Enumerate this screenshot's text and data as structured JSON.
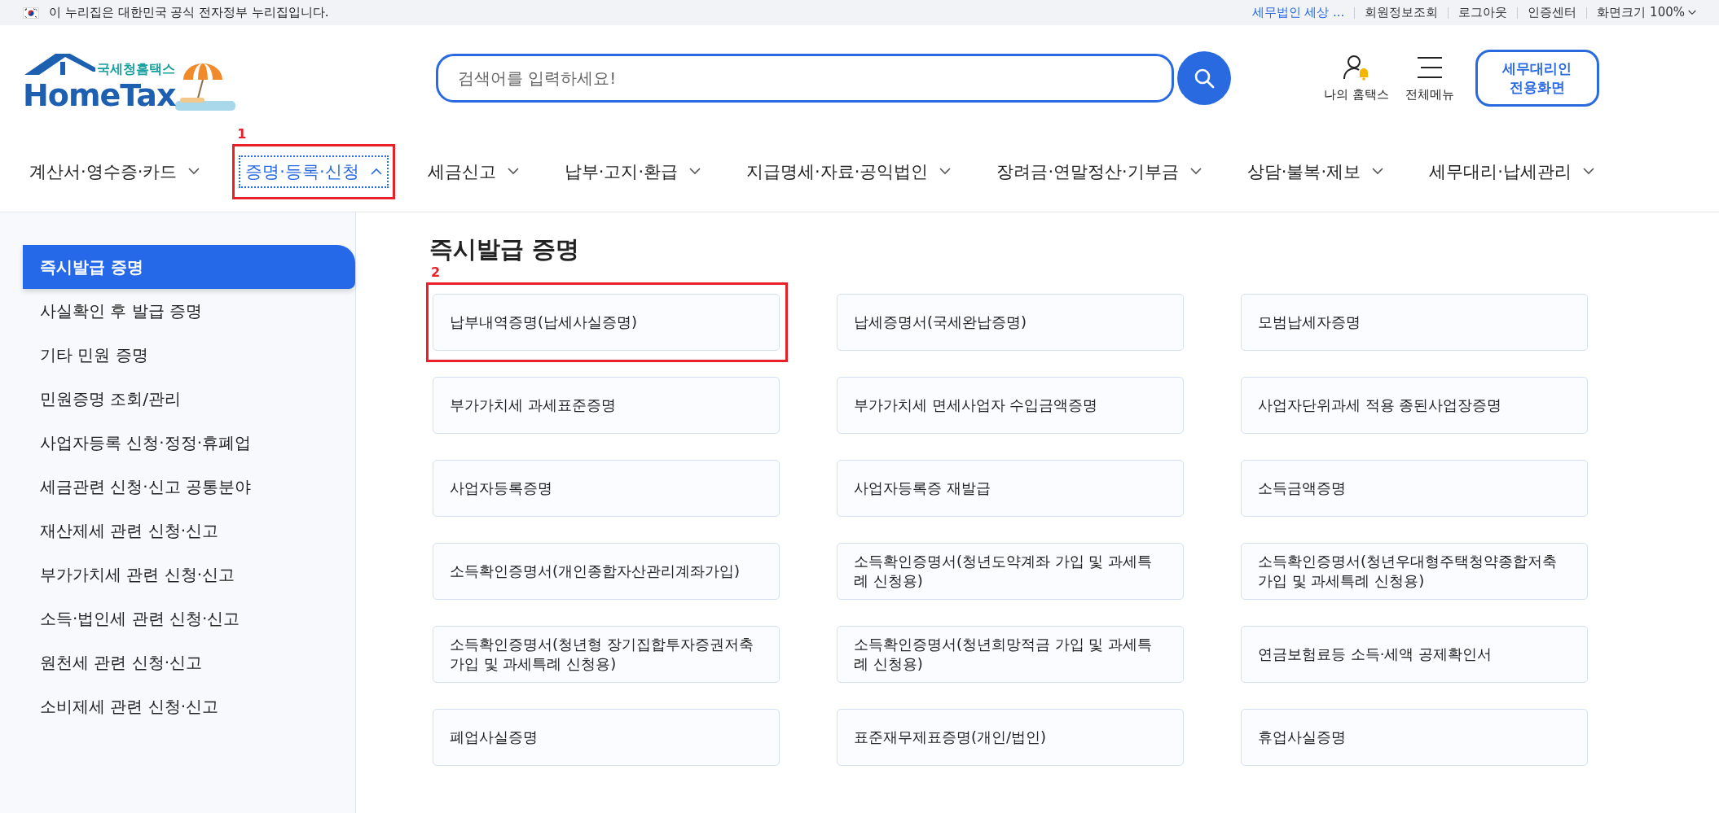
{
  "top_bar": {
    "notice": "이 누리집은 대한민국 공식 전자정부 누리집입니다.",
    "links": [
      {
        "label": "세무법인 세상 ...",
        "kind": "user"
      },
      {
        "label": "회원정보조회",
        "kind": "link"
      },
      {
        "label": "로그아웃",
        "kind": "link"
      },
      {
        "label": "인증센터",
        "kind": "link"
      },
      {
        "label": "화면크기 100%",
        "kind": "dropdown"
      }
    ]
  },
  "header": {
    "logo_sub": "국세청홈택스",
    "logo_main": "HomeTax",
    "search": {
      "placeholder": "검색어를 입력하세요!"
    },
    "my_hometax": "나의 홈택스",
    "all_menu": "전체메뉴",
    "agent_button": "세무대리인 전용화면"
  },
  "nav": [
    {
      "label": "계산서·영수증·카드",
      "selected": false
    },
    {
      "label": "증명·등록·신청",
      "selected": true,
      "annotation": "1"
    },
    {
      "label": "세금신고",
      "selected": false
    },
    {
      "label": "납부·고지·환급",
      "selected": false
    },
    {
      "label": "지급명세·자료·공익법인",
      "selected": false
    },
    {
      "label": "장려금·연말정산·기부금",
      "selected": false
    },
    {
      "label": "상담·불복·제보",
      "selected": false
    },
    {
      "label": "세무대리·납세관리",
      "selected": false
    }
  ],
  "sidebar": {
    "items": [
      {
        "label": "즉시발급 증명",
        "selected": true
      },
      {
        "label": "사실확인 후 발급 증명",
        "selected": false
      },
      {
        "label": "기타 민원 증명",
        "selected": false
      },
      {
        "label": "민원증명 조회/관리",
        "selected": false
      },
      {
        "label": "사업자등록 신청·정정·휴폐업",
        "selected": false
      },
      {
        "label": "세금관련 신청·신고 공통분야",
        "selected": false
      },
      {
        "label": "재산제세 관련 신청·신고",
        "selected": false
      },
      {
        "label": "부가가치세 관련 신청·신고",
        "selected": false
      },
      {
        "label": "소득·법인세 관련 신청·신고",
        "selected": false
      },
      {
        "label": "원천세 관련 신청·신고",
        "selected": false
      },
      {
        "label": "소비제세 관련 신청·신고",
        "selected": false
      }
    ]
  },
  "content": {
    "title": "즉시발급 증명",
    "cards": [
      {
        "label": "납부내역증명(납세사실증명)",
        "annotation": "2"
      },
      {
        "label": "납세증명서(국세완납증명)"
      },
      {
        "label": "모범납세자증명"
      },
      {
        "label": "부가가치세 과세표준증명"
      },
      {
        "label": "부가가치세 면세사업자 수입금액증명"
      },
      {
        "label": "사업자단위과세 적용 종된사업장증명"
      },
      {
        "label": "사업자등록증명"
      },
      {
        "label": "사업자등록증 재발급"
      },
      {
        "label": "소득금액증명"
      },
      {
        "label": "소득확인증명서(개인종합자산관리계좌가입)"
      },
      {
        "label": "소득확인증명서(청년도약계좌 가입 및 과세특례 신청용)"
      },
      {
        "label": "소득확인증명서(청년우대형주택청약종합저축 가입 및 과세특례 신청용)"
      },
      {
        "label": "소득확인증명서(청년형 장기집합투자증권저축 가입 및 과세특례 신청용)"
      },
      {
        "label": "소득확인증명서(청년희망적금 가입 및 과세특례 신청용)"
      },
      {
        "label": "연금보험료등 소득·세액 공제확인서"
      },
      {
        "label": "폐업사실증명"
      },
      {
        "label": "표준재무제표증명(개인/법인)"
      },
      {
        "label": "휴업사실증명"
      }
    ]
  }
}
